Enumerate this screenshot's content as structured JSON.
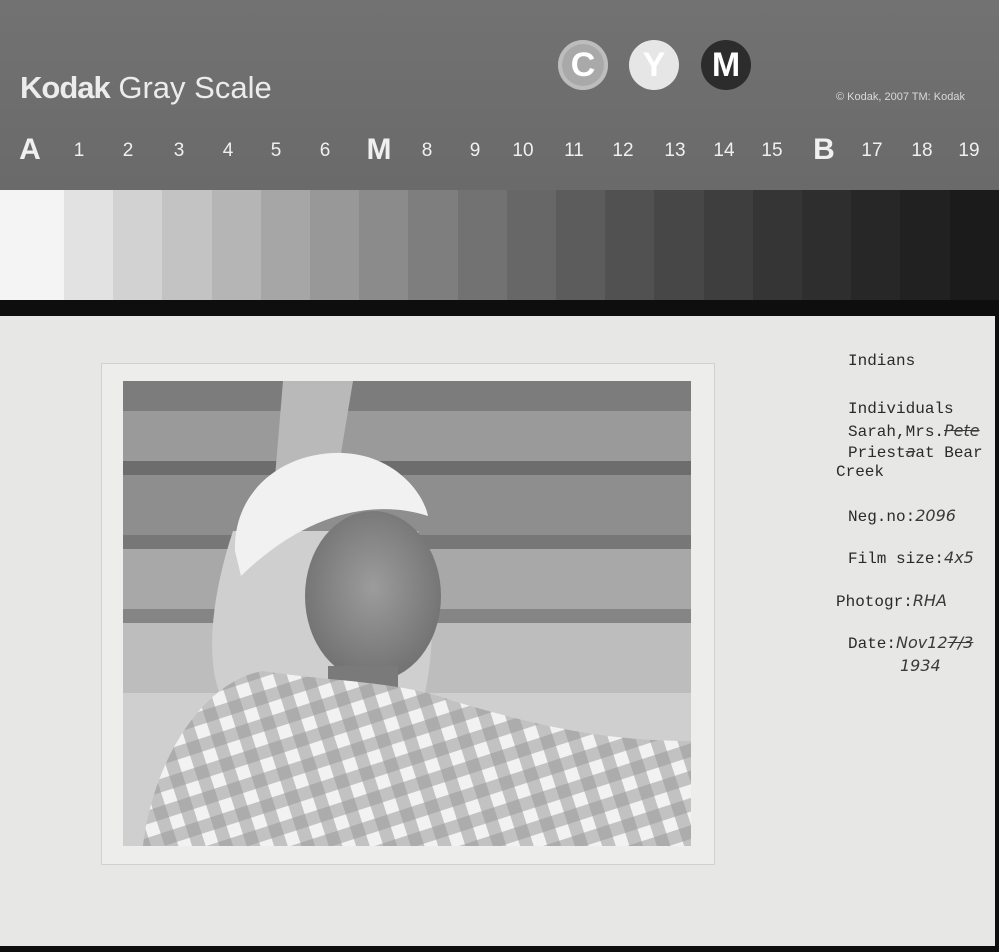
{
  "target": {
    "brand": "Kodak",
    "product": "Gray Scale",
    "copyright": "© Kodak, 2007  TM: Kodak",
    "color_dots": [
      {
        "letter": "C",
        "icon": "cyan-patch-icon"
      },
      {
        "letter": "Y",
        "icon": "yellow-patch-icon"
      },
      {
        "letter": "M",
        "icon": "magenta-patch-icon"
      }
    ],
    "steps": [
      "A",
      "1",
      "2",
      "3",
      "4",
      "5",
      "6",
      "M",
      "8",
      "9",
      "10",
      "11",
      "12",
      "13",
      "14",
      "15",
      "B",
      "17",
      "18",
      "19"
    ],
    "patch_colors": [
      "#f4f4f4",
      "#e2e2e2",
      "#d2d2d2",
      "#c3c3c3",
      "#b5b5b5",
      "#a6a6a6",
      "#989898",
      "#8b8b8b",
      "#7e7e7e",
      "#727272",
      "#676767",
      "#5c5c5c",
      "#515151",
      "#474747",
      "#3e3e3e",
      "#353535",
      "#2e2e2e",
      "#272727",
      "#212121",
      "#1b1b1b"
    ]
  },
  "card": {
    "lines": [
      {
        "key": "category",
        "text": "Indians"
      },
      {
        "key": "subcategory",
        "text": "Individuals"
      },
      {
        "key": "name",
        "text": "Sarah,Mrs."
      },
      {
        "key": "name_strike",
        "text": "Pete"
      },
      {
        "key": "place1",
        "text": "Priest"
      },
      {
        "key": "place1_strike",
        "text": "a"
      },
      {
        "key": "place2",
        "text": "at Bear"
      },
      {
        "key": "place3",
        "text": "Creek"
      },
      {
        "key": "neg_label",
        "text": "Neg.no:"
      },
      {
        "key": "neg_value",
        "text": "2096"
      },
      {
        "key": "film_label",
        "text": "Film size:"
      },
      {
        "key": "film_value",
        "text": "4x5"
      },
      {
        "key": "photog_label",
        "text": "Photogr:"
      },
      {
        "key": "photog_value",
        "text": "RHA"
      },
      {
        "key": "date_label",
        "text": "Date:"
      },
      {
        "key": "date_value",
        "text": "Nov12"
      },
      {
        "key": "date_strike",
        "text": "7/3"
      },
      {
        "key": "year",
        "text": "1934"
      }
    ]
  },
  "colors": {
    "card": "#e7e7e5",
    "ink": "#2a2a2a",
    "target_head": "#6e6e6e"
  }
}
